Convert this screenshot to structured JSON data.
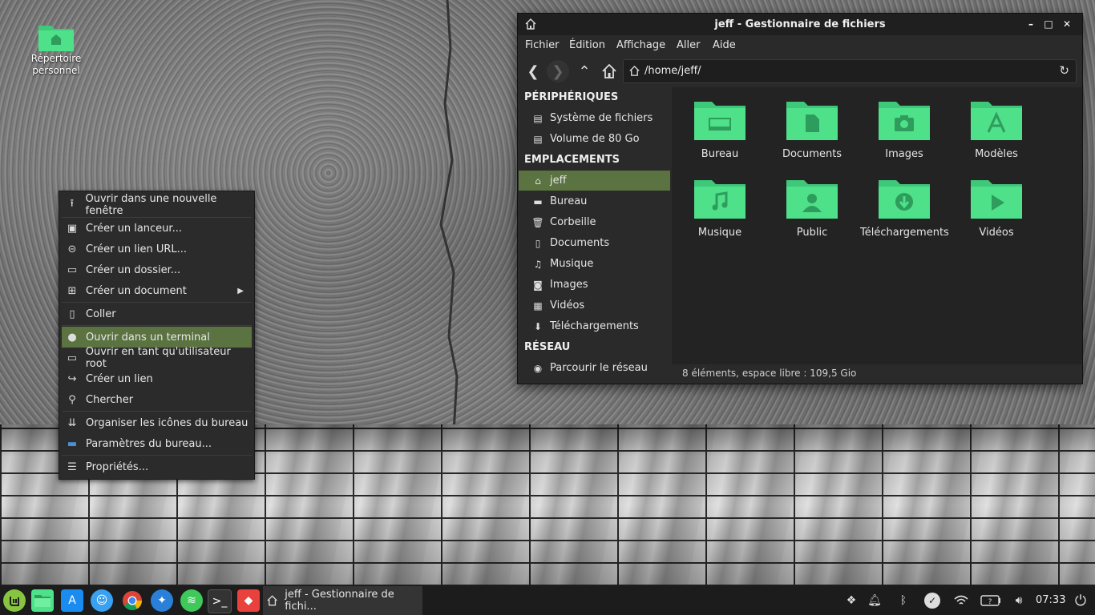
{
  "desktop": {
    "home_icon_label_line1": "Répertoire",
    "home_icon_label_line2": "personnel"
  },
  "context_menu": {
    "items": [
      {
        "label": "Ouvrir dans une nouvelle fenêtre",
        "icon": "upload-arrow-icon"
      },
      {
        "label": "Créer un lanceur...",
        "icon": "launcher-icon"
      },
      {
        "label": "Créer un lien URL...",
        "icon": "link-icon"
      },
      {
        "label": "Créer un dossier...",
        "icon": "folder-add-icon"
      },
      {
        "label": "Créer un document",
        "icon": "document-add-icon",
        "submenu": true
      },
      {
        "label": "Coller",
        "icon": "clipboard-icon"
      },
      {
        "label": "Ouvrir dans un terminal",
        "icon": "terminal-icon",
        "highlighted": true
      },
      {
        "label": "Ouvrir en tant qu'utilisateur root",
        "icon": "folder-root-icon"
      },
      {
        "label": "Créer un lien",
        "icon": "symlink-icon"
      },
      {
        "label": "Chercher",
        "icon": "search-icon"
      },
      {
        "label": "Organiser les icônes du bureau",
        "icon": "sort-icon"
      },
      {
        "label": "Paramètres du bureau...",
        "icon": "desktop-settings-icon"
      },
      {
        "label": "Propriétés...",
        "icon": "properties-icon"
      }
    ]
  },
  "file_manager": {
    "title": "jeff - Gestionnaire de fichiers",
    "menu": [
      "Fichier",
      "Édition",
      "Affichage",
      "Aller",
      "Aide"
    ],
    "path": "/home/jeff/",
    "sidebar": {
      "devices_header": "PÉRIPHÉRIQUES",
      "devices": [
        "Système de fichiers",
        "Volume de 80 Go"
      ],
      "places_header": "EMPLACEMENTS",
      "places": [
        "jeff",
        "Bureau",
        "Corbeille",
        "Documents",
        "Musique",
        "Images",
        "Vidéos",
        "Téléchargements"
      ],
      "network_header": "RÉSEAU",
      "network": [
        "Parcourir le réseau"
      ]
    },
    "folders": [
      "Bureau",
      "Documents",
      "Images",
      "Modèles",
      "Musique",
      "Public",
      "Téléchargements",
      "Vidéos"
    ],
    "status": "8 éléments, espace libre : 109,5 Gio",
    "accent_color": "#5a7340",
    "folder_color": "#4fe08a"
  },
  "panel": {
    "task_label": "jeff - Gestionnaire de fichi...",
    "clock": "07:33",
    "launchers": [
      "mint-menu-icon",
      "files-icon",
      "app-store-icon",
      "finder-icon",
      "chrome-icon",
      "safari-icon",
      "spotify-icon",
      "terminal-icon",
      "git-icon"
    ],
    "tray": [
      "dropbox-icon",
      "bell-icon",
      "bluetooth-icon",
      "check-icon",
      "wifi-icon",
      "battery-icon",
      "volume-icon",
      "power-icon"
    ]
  }
}
